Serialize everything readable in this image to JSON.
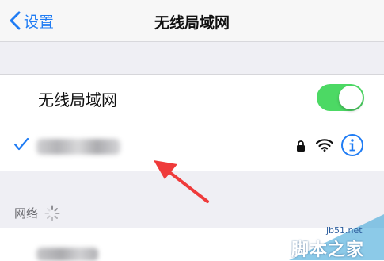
{
  "colors": {
    "accent": "#1f7cf4",
    "toggle_on": "#4cd964",
    "annotation_arrow": "#ef3b3b"
  },
  "navbar": {
    "back_label": "设置",
    "back_icon": "chevron-left-icon",
    "title": "无线局域网"
  },
  "wifi_section": {
    "toggle_label": "无线局域网",
    "toggle_state": "on",
    "connected_network": {
      "selected": true,
      "checkmark": "✓",
      "icons": [
        "lock-icon",
        "wifi-icon",
        "info-icon"
      ]
    }
  },
  "networks_section": {
    "header": "网络",
    "loading": true
  },
  "watermark": {
    "url": "jb51.net",
    "text": "脚本之家"
  }
}
